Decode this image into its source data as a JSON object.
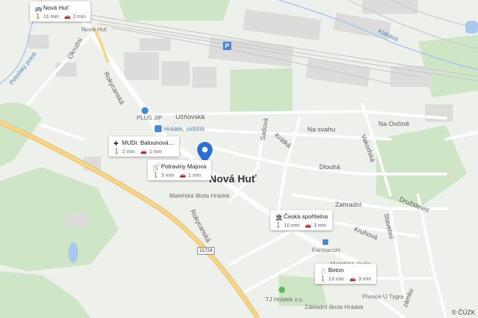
{
  "map": {
    "place_name": "Nová Huť",
    "copyright": "© ČÚZK",
    "road_number": "11724",
    "streets": {
      "okruzni": "Okružní",
      "pekelsky_potok": "Pekelský potok",
      "rokycanska_1": "Rokycanská",
      "rokycanska_2": "Rokycanská",
      "ucnovska": "Učňovská",
      "sadova": "Sadová",
      "kratka": "Krátká",
      "na_svahu": "Na svahu",
      "na_ovcine": "Na Ovčině",
      "vakorfska": "Vakorfská",
      "dlouha": "Dlouhá",
      "zahradni": "Zahradní",
      "druzstevni": "Družstevní",
      "stavebni": "Stavební",
      "kruhova": "Kruhová",
      "klabava": "Klabava",
      "nova_hut_small": "Nová Huť",
      "zamku": "zámku"
    },
    "pois": {
      "plus_jip": "PLUS JIP",
      "hradek_sidliste": "Hrádek, sídliště",
      "materska_skola": "Mateřská škola Hrádek",
      "farmacum": "Farmacum",
      "tj_hradek": "TJ Hrádek z.s.",
      "zakladni_skola": "Základní škola Hrádek",
      "pivnice": "Pivnice U Tygra",
      "matesk_partial": "Mateřská škola"
    },
    "parking_label": "P"
  },
  "cards": [
    {
      "icon": "bus-icon",
      "title": "Nová Huť",
      "walk": "11 min",
      "car": "2 min"
    },
    {
      "icon": "medical-icon",
      "title": "MUDr. Balounová…",
      "walk": "2 min",
      "car": "1 min"
    },
    {
      "icon": "cart-icon",
      "title": "Potraviny Majova",
      "walk": "3 min",
      "car": "1 min"
    },
    {
      "icon": "bank-icon",
      "title": "Česká spořitelna",
      "walk": "10 min",
      "car": "3 min"
    },
    {
      "icon": "restaurant-icon",
      "title": "Beton",
      "walk": "13 min",
      "car": "3 min"
    }
  ],
  "colors": {
    "background": "#eef0eb",
    "green": "#c9e3c0",
    "road_main": "#f6d58a",
    "road_minor": "#ffffff",
    "water": "#a9c8ee",
    "pin": "#2a6fd6"
  }
}
